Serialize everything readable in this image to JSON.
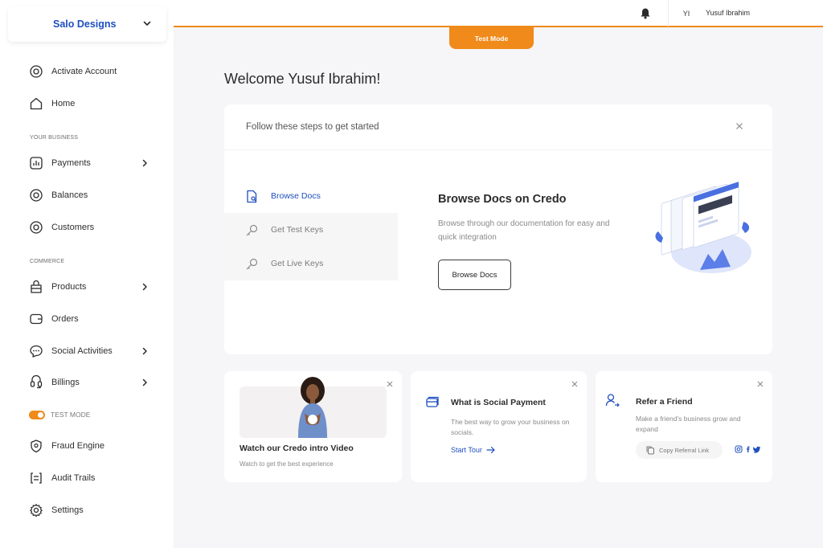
{
  "org": {
    "name": "Salo Designs"
  },
  "sidebar": {
    "items": [
      {
        "label": "Activate Account",
        "icon": "activate-icon"
      },
      {
        "label": "Home",
        "icon": "home-icon"
      },
      {
        "label": "Payments",
        "icon": "payments-icon"
      },
      {
        "label": "Balances",
        "icon": "balances-icon"
      },
      {
        "label": "Customers",
        "icon": "customers-icon"
      },
      {
        "label": "Products",
        "icon": "products-icon"
      },
      {
        "label": "Orders",
        "icon": "orders-icon"
      },
      {
        "label": "Social Activities",
        "icon": "social-activities-icon"
      },
      {
        "label": "Billings",
        "icon": "billings-icon"
      },
      {
        "label": "Fraud Engine",
        "icon": "fraud-engine-icon"
      },
      {
        "label": "Audit Trails",
        "icon": "audit-trails-icon"
      },
      {
        "label": "Settings",
        "icon": "settings-icon"
      }
    ],
    "sections": {
      "business": "YOUR BUSINESS",
      "commerce": "COMMERCE"
    },
    "test_mode_label": "TEST MODE",
    "test_mode_on": true
  },
  "header": {
    "user_initials": "YI",
    "user_name": "Yusuf Ibrahim",
    "test_mode_tab": "Test Mode"
  },
  "main": {
    "welcome": "Welcome Yusuf Ibrahim!",
    "steps_card": {
      "header": "Follow these steps to get started",
      "steps": [
        {
          "label": "Browse Docs",
          "active": true
        },
        {
          "label": "Get Test Keys",
          "active": false
        },
        {
          "label": "Get Live Keys",
          "active": false
        }
      ],
      "detail_title": "Browse Docs on Credo",
      "detail_desc": "Browse through our documentation for easy and quick integration",
      "detail_button": "Browse Docs"
    },
    "cards": {
      "video": {
        "title": "Watch our Credo intro Video",
        "subtitle": "Watch to get the best experience"
      },
      "social": {
        "title": "What is Social  Payment",
        "desc": "The best way to grow your business on socials.",
        "link": "Start Tour"
      },
      "referral": {
        "title": "Refer a Friend",
        "desc": "Make a friend's business grow and expand",
        "button": "Copy Referral Link",
        "socials": [
          "instagram-icon",
          "facebook-icon",
          "twitter-icon"
        ]
      }
    }
  },
  "colors": {
    "accent": "#f08a1a",
    "brand_blue": "#1f4fbf"
  }
}
